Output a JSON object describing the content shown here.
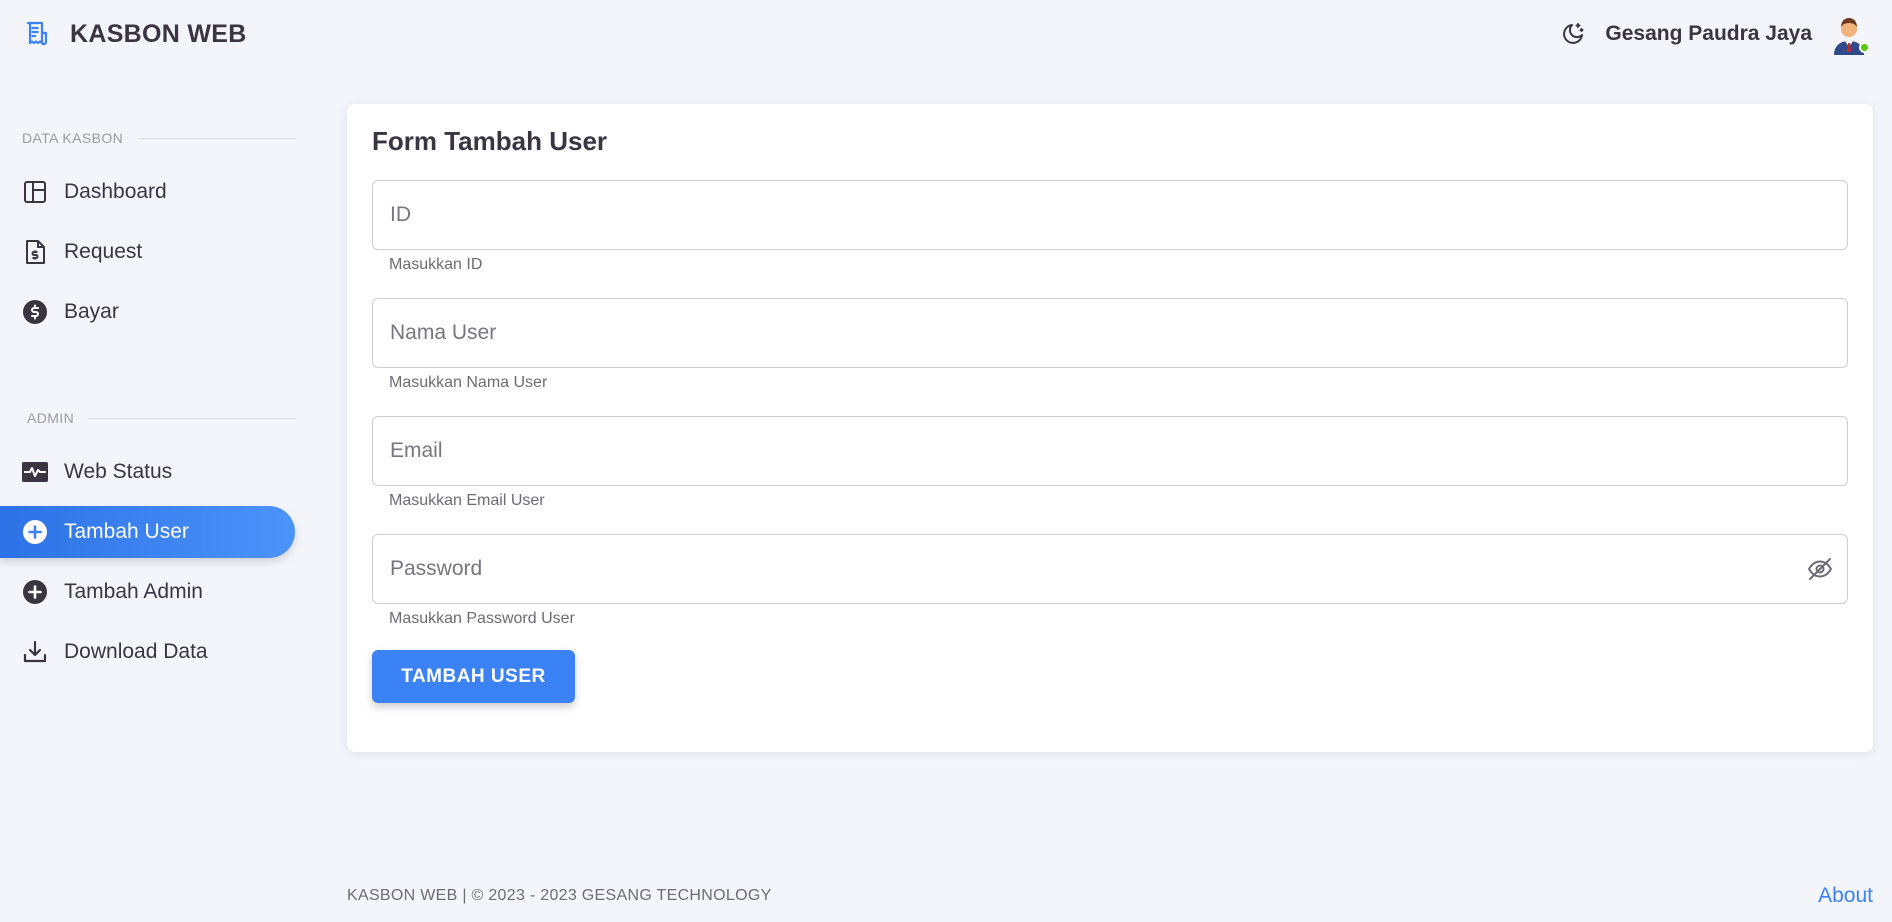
{
  "app": {
    "title": "KASBON WEB",
    "brand_icon": "receipt-icon",
    "accent_color": "#3b82f6"
  },
  "header": {
    "user_name": "Gesang Paudra Jaya",
    "theme_icon": "moon-star-icon",
    "status_color": "#56ca00"
  },
  "sidebar": {
    "sections": [
      {
        "label": "DATA KASBON",
        "items": [
          {
            "label": "Dashboard",
            "icon": "layout-icon"
          },
          {
            "label": "Request",
            "icon": "invoice-icon"
          },
          {
            "label": "Bayar",
            "icon": "dollar-icon"
          }
        ]
      },
      {
        "label": "ADMIN",
        "items": [
          {
            "label": "Web Status",
            "icon": "pulse-icon"
          },
          {
            "label": "Tambah User",
            "icon": "plus-circle-icon",
            "active": true
          },
          {
            "label": "Tambah Admin",
            "icon": "plus-circle-icon"
          },
          {
            "label": "Download Data",
            "icon": "download-icon"
          }
        ]
      }
    ]
  },
  "form": {
    "title": "Form Tambah User",
    "fields": [
      {
        "placeholder": "ID",
        "value": "",
        "helper": "Masukkan ID"
      },
      {
        "placeholder": "Nama User",
        "value": "",
        "helper": "Masukkan Nama User"
      },
      {
        "placeholder": "Email",
        "value": "",
        "helper": "Masukkan Email User"
      },
      {
        "placeholder": "Password",
        "value": "",
        "helper": "Masukkan Password User",
        "toggle_icon": "eye-off-icon"
      }
    ],
    "submit_label": "TAMBAH USER"
  },
  "footer": {
    "copyright": "KASBON WEB | © 2023 - 2023 GESANG TECHNOLOGY",
    "about_label": "About"
  }
}
